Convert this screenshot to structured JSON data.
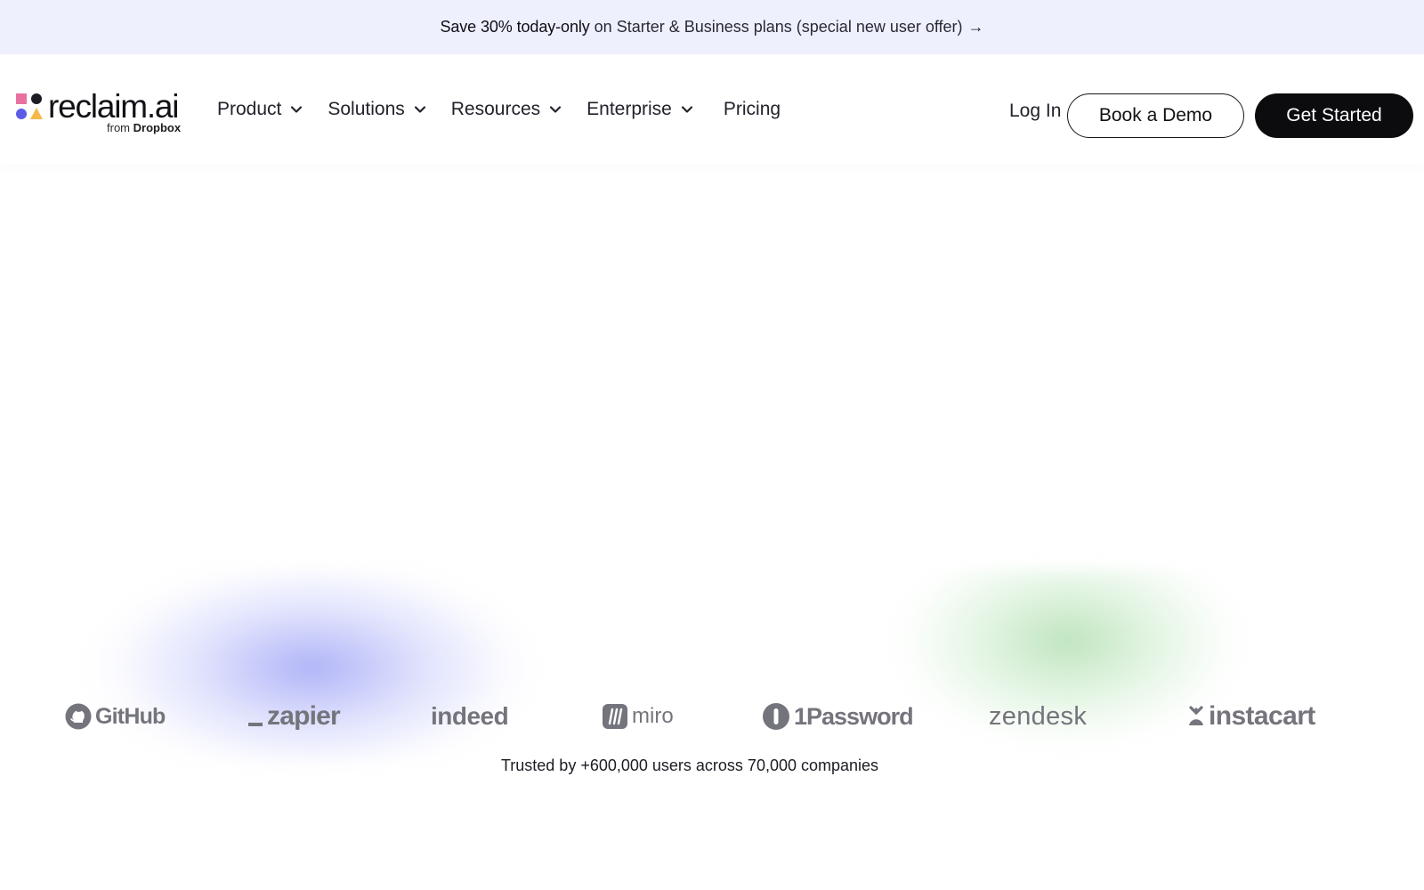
{
  "promo": {
    "strong": "Save 30% today-only",
    "rest": "on Starter & Business plans (special new user offer)",
    "arrow": "→"
  },
  "logo": {
    "name": "reclaim.ai",
    "sub_prefix": "from",
    "sub_brand": "Dropbox",
    "colors": [
      "#e8719f",
      "#1c1c24",
      "#5b5be8",
      "#f5b94a"
    ]
  },
  "nav": {
    "items": [
      {
        "label": "Product",
        "icon": "chevron-down-icon"
      },
      {
        "label": "Solutions",
        "icon": "chevron-down-icon"
      },
      {
        "label": "Resources",
        "icon": "chevron-down-icon"
      },
      {
        "label": "Enterprise",
        "icon": "chevron-down-icon"
      },
      {
        "label": "Pricing"
      }
    ]
  },
  "auth": {
    "login": "Log In",
    "demo": "Book a Demo",
    "start": "Get Started"
  },
  "companies": [
    "GitHub",
    "zapier",
    "indeed",
    "miro",
    "1Password",
    "zendesk",
    "instacart"
  ],
  "trusted": "Trusted by +600,000 users across 70,000 companies",
  "colors": {
    "banner_bg": "#eef0fd",
    "accent_dark": "#0c0c0f",
    "logo_gray": "#74747c",
    "glow_blue": "#969bf5",
    "glow_green": "#aadcaa"
  }
}
